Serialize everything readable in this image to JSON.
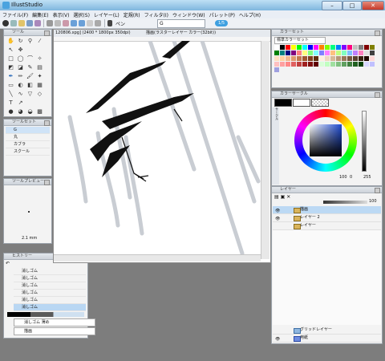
{
  "window": {
    "title": "IllustStudio",
    "controls": {
      "minimize": "–",
      "maximize": "□",
      "close": "✕"
    }
  },
  "menubar": {
    "items": [
      "ファイル(F)",
      "編集(E)",
      "表示(V)",
      "選択(S)",
      "レイヤー(L)",
      "定規(R)",
      "フィルタ(I)",
      "ウィンドウ(W)",
      "パレット(P)",
      "ヘルプ(H)"
    ]
  },
  "toolbar": {
    "pen_label": "ペン",
    "tool_value": "G",
    "pill": "1/5"
  },
  "tool_panel": {
    "title": "ツール"
  },
  "tool_set_panel": {
    "title": "ツールセット",
    "items": [
      "G",
      "丸",
      "カブラ",
      "スクール"
    ]
  },
  "tool_preview_panel": {
    "title": "ツールプレビュー",
    "size": "2.1 mm"
  },
  "history_panel": {
    "title": "ヒストリー",
    "items": [
      "消しゴム",
      "消しゴム",
      "消しゴム",
      "消しゴム",
      "消しゴム",
      "消しゴム"
    ],
    "selected_index": 5,
    "footer_label": "消しゴム 薄め",
    "footer_label2": "描画"
  },
  "document": {
    "tab": "120806.xpg] (2400 * 1800px 350dpi)",
    "title": "描画(ラスターレイヤー カラー(32bit))"
  },
  "color_set_panel": {
    "title": "カラーセット",
    "set_name": "標準カラーセット",
    "colors": [
      "#ffffff",
      "#000000",
      "#ff0000",
      "#ffff00",
      "#00ff00",
      "#00ffff",
      "#0000ff",
      "#ff00ff",
      "#ff8000",
      "#80ff00",
      "#00ff80",
      "#0080ff",
      "#8000ff",
      "#ff0080",
      "#c0c0c0",
      "#808080",
      "#800000",
      "#808000",
      "#008000",
      "#008080",
      "#000080",
      "#800080",
      "#ff8080",
      "#ffff80",
      "#80ff80",
      "#80ffff",
      "#8080ff",
      "#ff80ff",
      "#ffc080",
      "#c0ff80",
      "#80ffc0",
      "#80c0ff",
      "#c080ff",
      "#ff80c0",
      "#e0e0e0",
      "#404040",
      "#ffe0c0",
      "#ffd0a0",
      "#f0b890",
      "#e09870",
      "#c07850",
      "#a05830",
      "#804020",
      "#603010",
      "#fff0e0",
      "#f0d8c0",
      "#d8b898",
      "#b89878",
      "#987858",
      "#785840",
      "#584030",
      "#382010",
      "#200800",
      "#ffd8d8",
      "#ffc0c0",
      "#ffa0a0",
      "#ff8888",
      "#e06060",
      "#c04040",
      "#a02020",
      "#801010",
      "#600000",
      "#d8ffd8",
      "#c0ffc0",
      "#a0e0a0",
      "#80c080",
      "#60a060",
      "#408040",
      "#206020",
      "#004000",
      "#d8d8ff",
      "#c0c0ff",
      "#a0a0e0"
    ]
  },
  "color_panel": {
    "title": "カラーサークル",
    "main_color": "#000000",
    "sub_color": "#ffffff",
    "value_s": "100",
    "value_v": "0",
    "value_h": "255",
    "side_tabs": [
      "サークル",
      "スライダー",
      "RGB",
      "HSV",
      "CMY"
    ]
  },
  "layer_panel": {
    "title": "レイヤー",
    "opacity": "100",
    "layers": [
      {
        "name": "描画",
        "selected": true,
        "visible": true
      },
      {
        "name": "レイヤー 2",
        "selected": false,
        "visible": true
      },
      {
        "name": "レイヤー",
        "selected": false,
        "visible": false
      }
    ],
    "bottom_layers": [
      {
        "name": "グリッドレイヤー"
      },
      {
        "name": "用紙"
      }
    ]
  }
}
